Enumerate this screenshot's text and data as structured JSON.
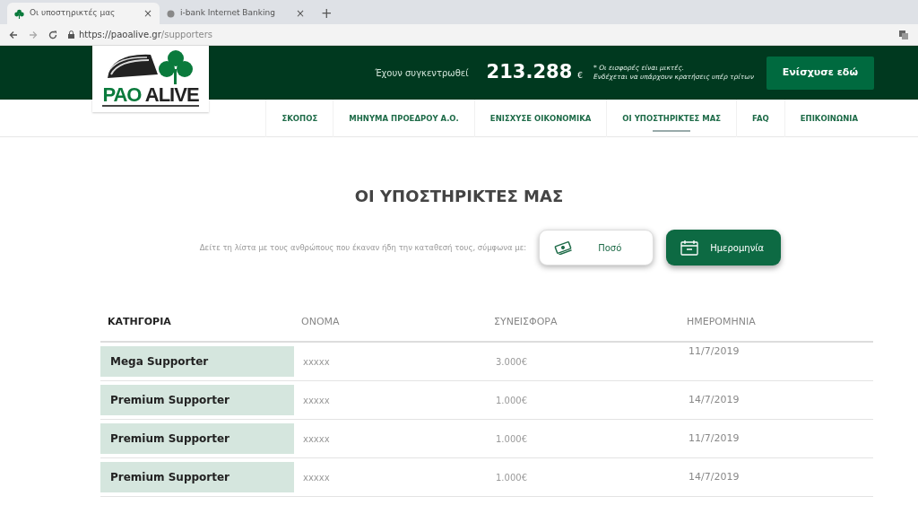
{
  "browser": {
    "tabs": [
      {
        "title": "Οι υποστηρικτές μας",
        "selected": true,
        "close": "×"
      },
      {
        "title": "i-bank Internet Banking",
        "selected": false,
        "close": "×"
      }
    ],
    "new_tab": "+",
    "url_host": "https://paoalive.gr",
    "url_path": "/supporters"
  },
  "header": {
    "logo": {
      "part_1": "PAO",
      "part_2": "ALIVE"
    },
    "raised_label": "Έχουν συγκεντρωθεί",
    "amount": "213.288",
    "currency": "€",
    "note_1": "* Οι εισφορές είναι μικτές.",
    "note_2": "Ενδέχεται να υπάρχουν κρατήσεις υπέρ τρίτων",
    "cta": "Ενίσχυσε εδώ"
  },
  "nav": [
    {
      "label": "ΣΚΟΠΟΣ",
      "selected": false
    },
    {
      "label": "ΜΗΝΥΜΑ ΠΡΟΕΔΡΟΥ Α.Ο.",
      "selected": false
    },
    {
      "label": "ΕΝΙΣΧΥΣΕ ΟΙΚΟΝΟΜΙΚΑ",
      "selected": false
    },
    {
      "label": "ΟΙ ΥΠΟΣΤΗΡΙΚΤΕΣ ΜΑΣ",
      "selected": true
    },
    {
      "label": "FAQ",
      "selected": false
    },
    {
      "label": "ΕΠΙΚΟΙΝΩΝΙΑ",
      "selected": false
    }
  ],
  "page_title": "ΟΙ ΥΠΟΣΤΗΡΙΚΤΕΣ ΜΑΣ",
  "sort": {
    "label": "Δείτε τη λίστα με τους ανθρώπους που έκαναν ήδη την καταθεσή τους, σύμφωνα με:",
    "options": [
      {
        "kind": "money",
        "label": "Ποσό",
        "selected": false
      },
      {
        "kind": "calendar",
        "label": "Ημερομηνία",
        "selected": true
      }
    ]
  },
  "table": {
    "columns": [
      "ΚΑΤΗΓΟΡΙΑ",
      "ΟΝΟΜΑ",
      "ΣΥΝΕΙΣΦΟΡΑ",
      "ΗΜΕΡΟΜΗΝΙΑ"
    ],
    "rows": [
      [
        "Mega Supporter",
        "xxxxx",
        "3.000€",
        "11/7/2019"
      ],
      [
        "Premium Supporter",
        "xxxxx",
        "1.000€",
        "14/7/2019"
      ],
      [
        "Premium Supporter",
        "xxxxx",
        "1.000€",
        "11/7/2019"
      ],
      [
        "Premium Supporter",
        "xxxxx",
        "1.000€",
        "14/7/2019"
      ]
    ]
  }
}
